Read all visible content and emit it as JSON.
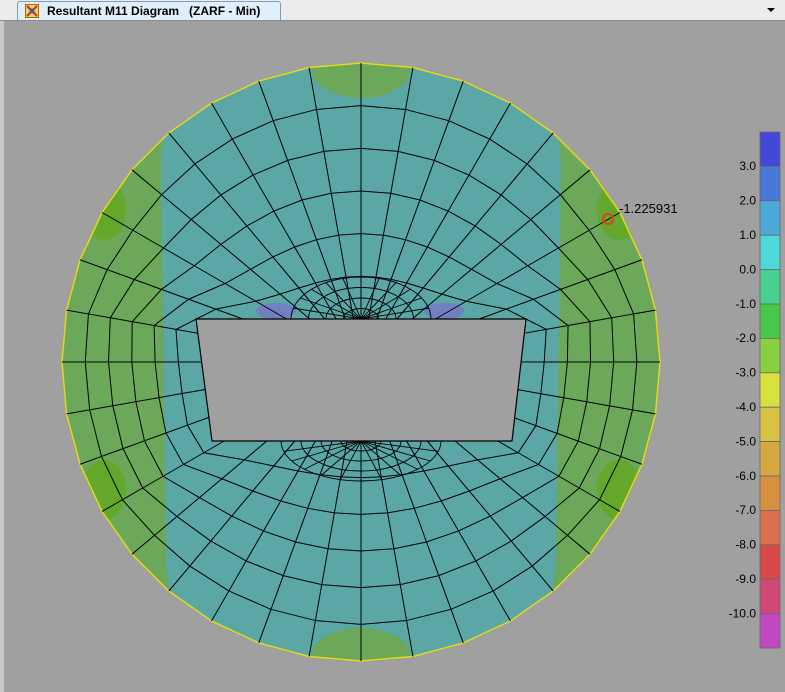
{
  "tab": {
    "title": "Resultant M11 Diagram   (ZARF - Min)",
    "icon": "structure-diagram-icon"
  },
  "toolbar": {
    "dropdown_icon": "chevron-down-icon"
  },
  "annotation": {
    "value": "-1.225931"
  },
  "colors": {
    "background": "#a0a0a0",
    "mesh_line": "#000000",
    "outline": "#e8d81c",
    "marker": "#e04020",
    "teal_fill": "#5ba7a6",
    "green_fill": "#6ba85a"
  },
  "legend": {
    "bands": [
      {
        "color": "#4448d8"
      },
      {
        "color": "#4878d8"
      },
      {
        "color": "#4ba8d8"
      },
      {
        "color": "#4ed8d8"
      },
      {
        "color": "#48d090"
      },
      {
        "color": "#48c848"
      },
      {
        "color": "#88d040"
      },
      {
        "color": "#d8e040"
      },
      {
        "color": "#d8c040"
      },
      {
        "color": "#d8a840"
      },
      {
        "color": "#d89040"
      },
      {
        "color": "#d87050"
      },
      {
        "color": "#d84848"
      },
      {
        "color": "#d04878"
      },
      {
        "color": "#c048c0"
      }
    ],
    "labels": [
      "3.0",
      "2.0",
      "1.0",
      "0.0",
      "-1.0",
      "-2.0",
      "-3.0",
      "-4.0",
      "-5.0",
      "-6.0",
      "-7.0",
      "-8.0",
      "-9.0",
      "-10.0"
    ]
  }
}
